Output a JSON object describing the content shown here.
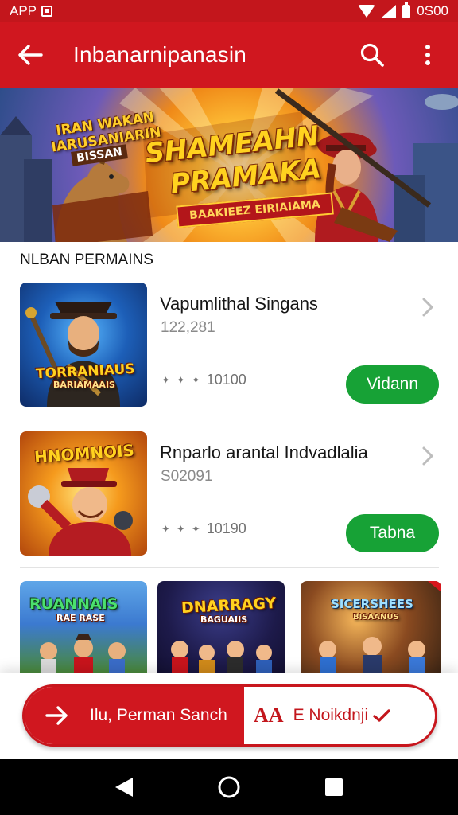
{
  "status_bar": {
    "app_label": "APP",
    "right_text": "0S00"
  },
  "app_bar": {
    "title": "Inbanarnipanasin"
  },
  "banner": {
    "title_line1": "SHAMEAHN",
    "title_line2": "PRAMAKA",
    "ribbon": "BAAKIEEZ EIRIAIAMA",
    "badge_line1": "IRAN WAKAN",
    "badge_line2": "IARUSANIARIN",
    "badge_line3": "BISSAN"
  },
  "section": {
    "title": "NLBAN PERMAINS"
  },
  "items": [
    {
      "title": "Vapumlithal Singans",
      "subtitle": "122,281",
      "rating": "10100",
      "button": "Vidann",
      "thumb_line1": "TORRANIAUS",
      "thumb_line2": "BARIAMAAIS"
    },
    {
      "title": "Rnparlo arantal Indvadlalia",
      "subtitle": "S02091",
      "rating": "10190",
      "button": "Tabna",
      "thumb_line1": "HNOMNOIS"
    }
  ],
  "tiles": [
    {
      "label": "RUANNAIS",
      "sublabel": "RAE RASE"
    },
    {
      "label": "DNARRAGY",
      "sublabel": "BAGUAIIS"
    },
    {
      "label": "SICERSHEES",
      "sublabel": "BISAANUS"
    }
  ],
  "bottom_bar": {
    "left_label": "Ilu, Perman Sanch",
    "aa_label": "AA",
    "right_label": "E Noikdnji"
  },
  "colors": {
    "primary_red": "#d0171f",
    "status_red": "#c3161c",
    "action_green": "#17a236"
  },
  "icons": [
    "back-arrow-icon",
    "search-icon",
    "more-vert-icon",
    "chevron-right-icon",
    "arrow-right-icon",
    "check-icon",
    "nav-back-icon",
    "nav-home-icon",
    "nav-recents-icon"
  ]
}
